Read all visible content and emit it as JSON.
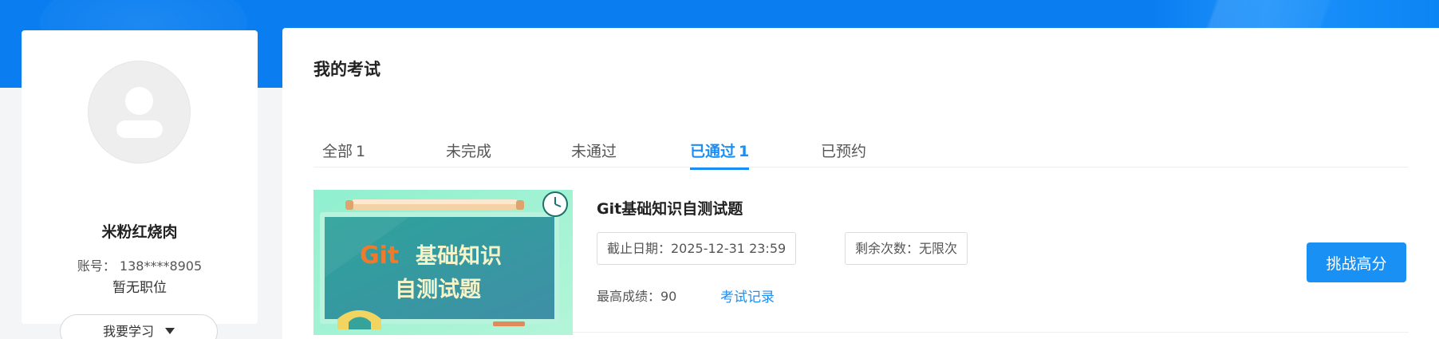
{
  "profile": {
    "name": "米粉红烧肉",
    "account": "账号：  138****8905",
    "position": "暂无职位",
    "learn_button": "我要学习"
  },
  "main": {
    "title": "我的考试",
    "tabs": [
      {
        "label": "全部",
        "count": "1",
        "active": false
      },
      {
        "label": "未完成",
        "count": "",
        "active": false
      },
      {
        "label": "未通过",
        "count": "",
        "active": false
      },
      {
        "label": "已通过",
        "count": "1",
        "active": true
      },
      {
        "label": "已预约",
        "count": "",
        "active": false
      }
    ]
  },
  "exam": {
    "title": "Git基础知识自测试题",
    "deadline": "截止日期：2025-12-31 23:59",
    "attempts": "剩余次数：无限次",
    "best_score": "最高成绩：90",
    "records_link": "考试记录",
    "challenge_button": "挑战高分",
    "thumbnail": {
      "line1_brand": "Git",
      "line1_rest": "基础知识",
      "line2": "自测试题"
    }
  },
  "colors": {
    "accent": "#1890f4",
    "banner": "#0a7ef0"
  }
}
